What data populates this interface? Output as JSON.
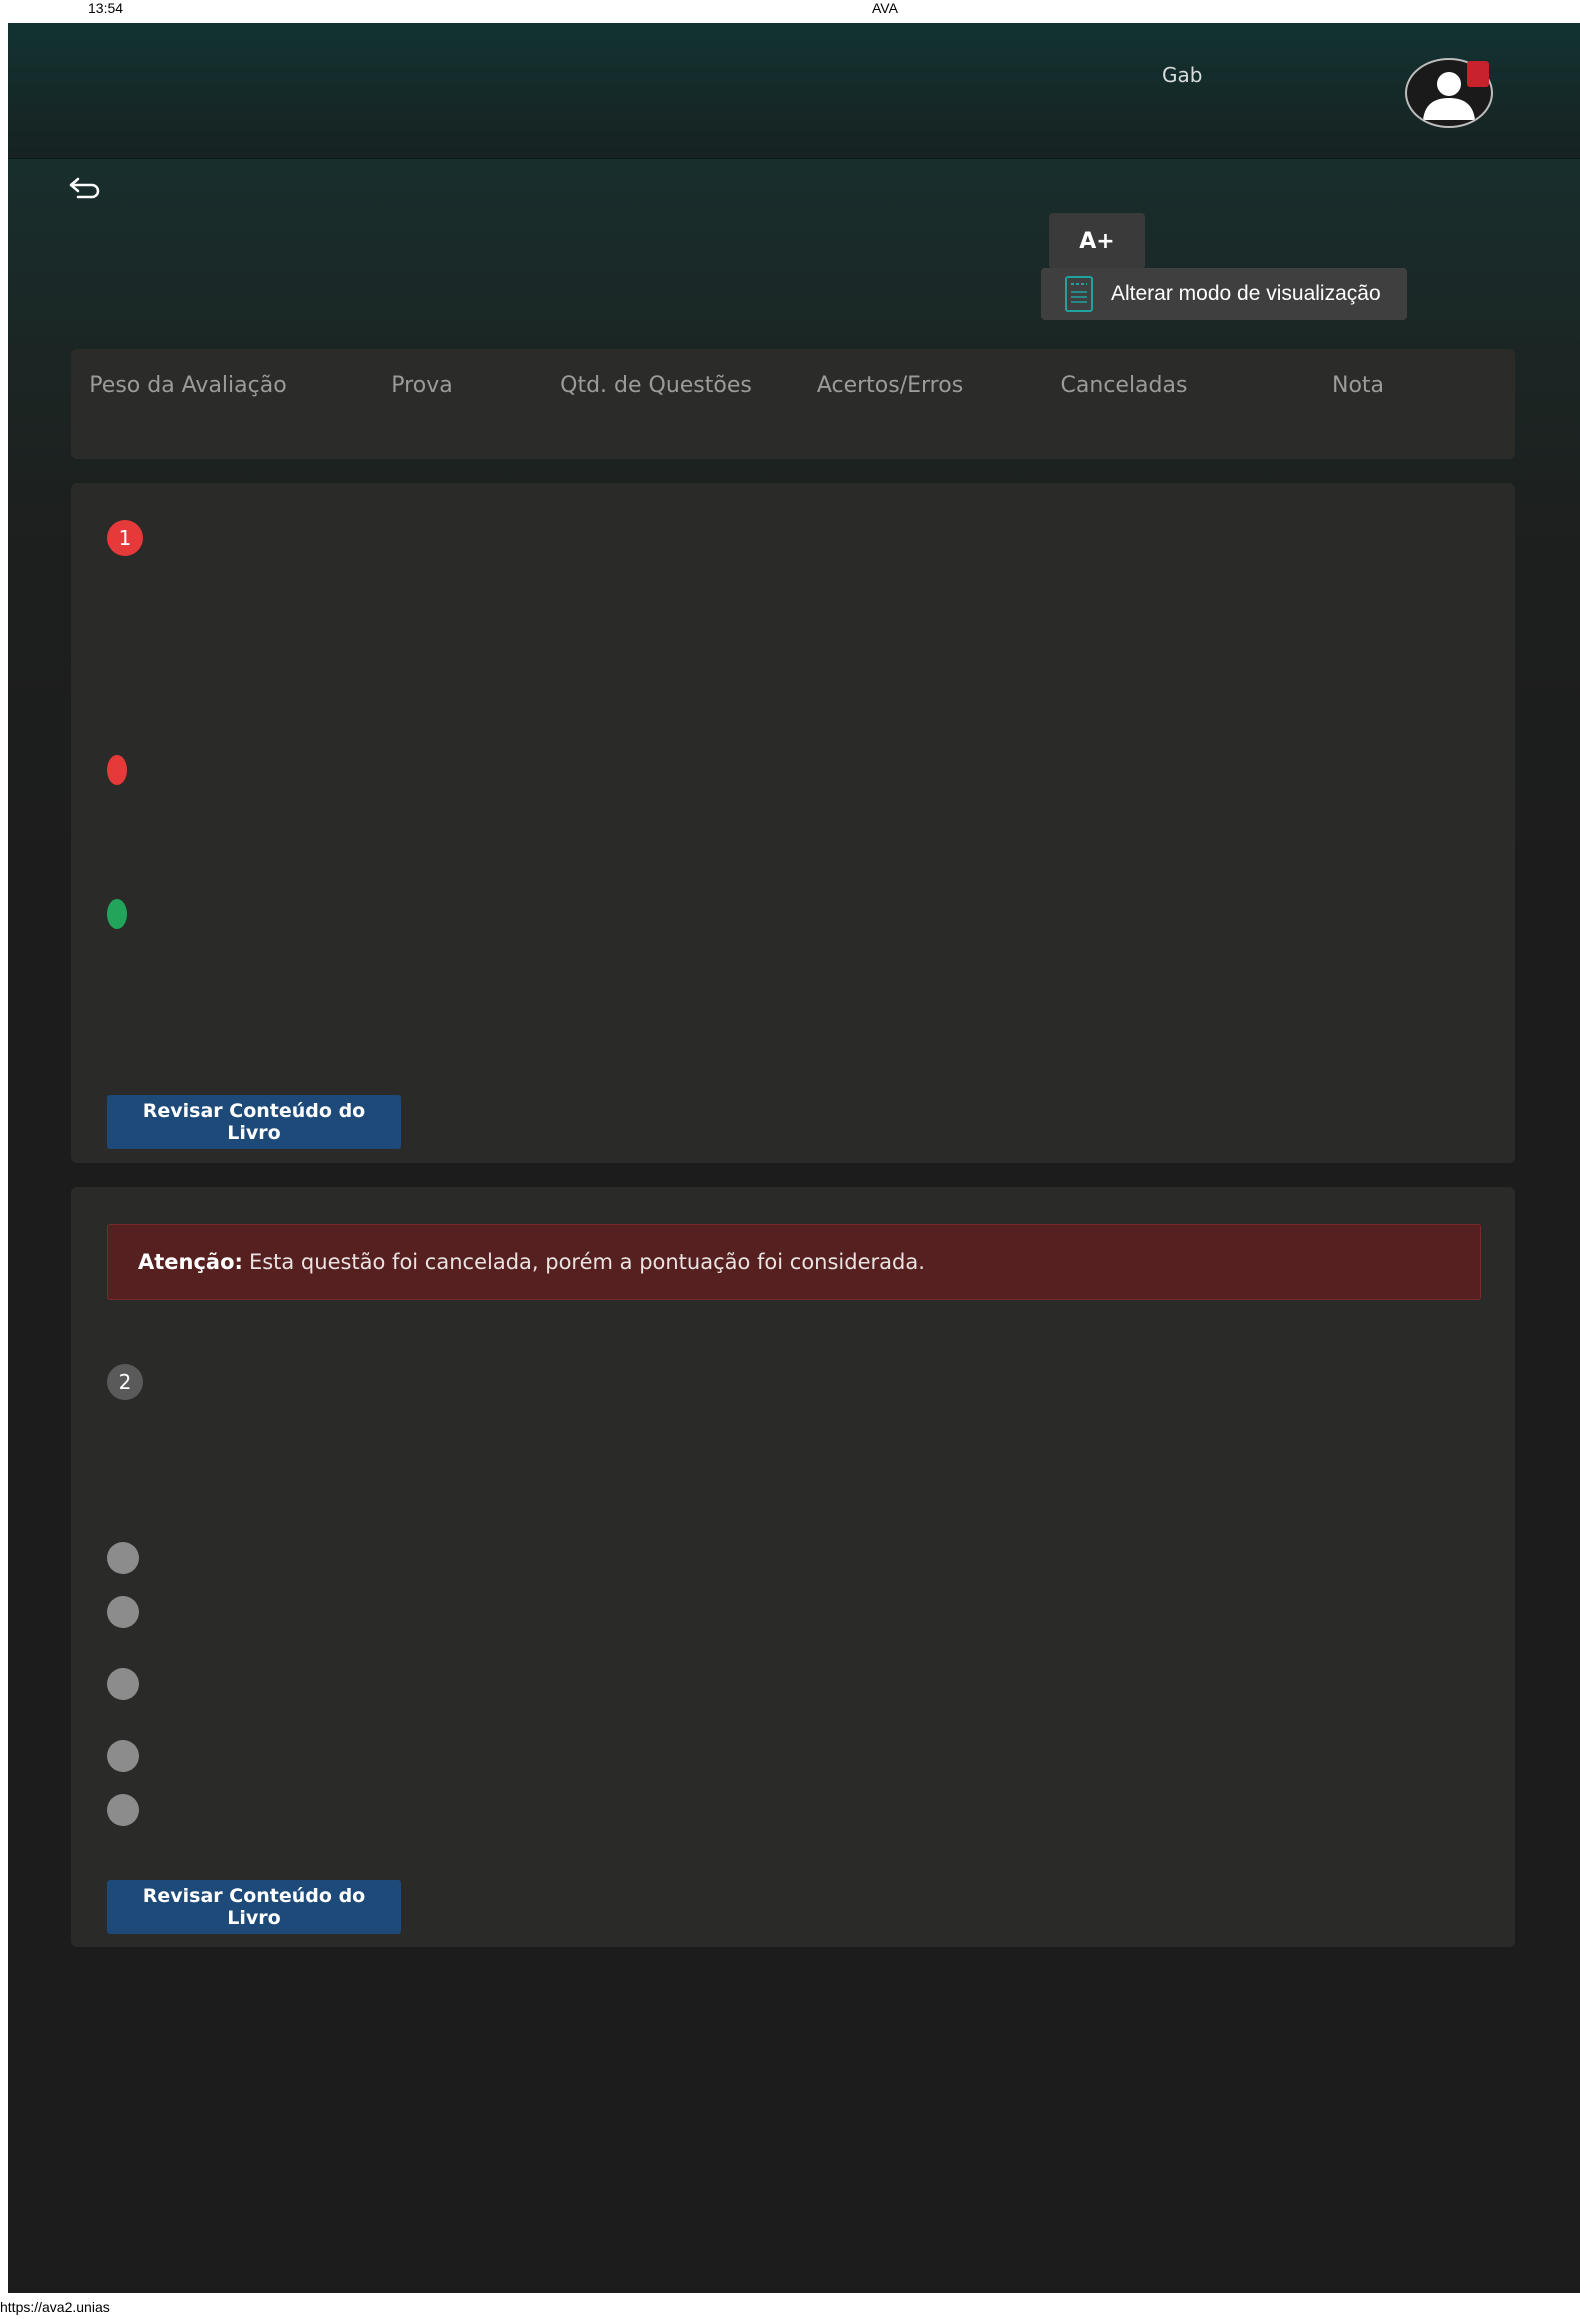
{
  "print_header": {
    "time": "13:54",
    "title": "AVA"
  },
  "print_footer": {
    "url": "https://ava2.unias"
  },
  "topbar": {
    "username": "Gab"
  },
  "toolbar": {
    "font_increase_label": "A+",
    "view_mode_label": "Alterar modo de visualização"
  },
  "summary": {
    "columns": [
      "Peso da Avaliação",
      "Prova",
      "Qtd. de Questões",
      "Acertos/Erros",
      "Canceladas",
      "Nota"
    ]
  },
  "questions": [
    {
      "number": "1",
      "status_color": "#e63a3a",
      "answer_markers": [
        "#e63a3a",
        "#22a55b"
      ],
      "review_label": "Revisar Conteúdo do Livro"
    },
    {
      "number": "2",
      "status_color": "#5a5a5a",
      "alert": {
        "strong": "Atenção:",
        "message": "Esta questão foi cancelada, porém a pontuação foi considerada."
      },
      "option_marker_color": "#8c8c8c",
      "review_label": "Revisar Conteúdo do Livro"
    }
  ]
}
